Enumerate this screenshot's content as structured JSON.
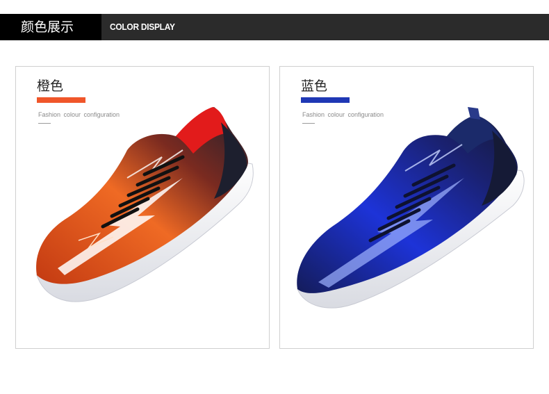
{
  "header": {
    "title_cn": "颜色展示",
    "title_en": "COLOR DISPLAY"
  },
  "cards": [
    {
      "title": "橙色",
      "subtitle": "Fashion colour configuration",
      "accent": "#f0562a",
      "shoe_colors": {
        "upper": "#e2571e",
        "dark": "#1d1f2e",
        "collar": "#e21b1b",
        "sole": "#f1f1f3"
      }
    },
    {
      "title": "蓝色",
      "subtitle": "Fashion colour configuration",
      "accent": "#1f38b5",
      "shoe_colors": {
        "upper": "#1c2fd0",
        "dark": "#151a36",
        "collar": "#1b2a6a",
        "sole": "#f1f1f3"
      }
    }
  ]
}
